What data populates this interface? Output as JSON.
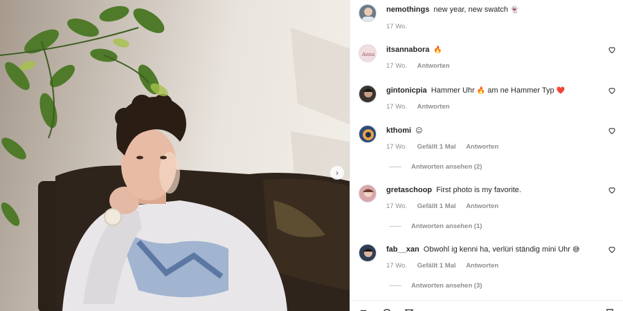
{
  "photo": {
    "next_icon": "chevron-right-icon"
  },
  "comments": [
    {
      "user": "nemothings",
      "text": "new year, new swatch",
      "emoji": "👻",
      "time": "17 Wo.",
      "likes": "",
      "reply": "",
      "view_replies": "",
      "avatar_color": "#6c7a86"
    },
    {
      "user": "itsannabora",
      "text": "",
      "emoji": "🔥",
      "time": "17 Wo.",
      "likes": "",
      "reply": "Antworten",
      "view_replies": "",
      "avatar_color": "#e9c9cf"
    },
    {
      "user": "gintonicpia",
      "text": "Hammer Uhr",
      "emoji": "🔥",
      "text2": "am ne Hammer Typ",
      "emoji2": "❤️",
      "time": "17 Wo.",
      "likes": "",
      "reply": "Antworten",
      "view_replies": "",
      "avatar_color": "#3a3532"
    },
    {
      "user": "kthomi",
      "text": "",
      "emoji": "☺",
      "time": "17 Wo.",
      "likes": "Gefällt 1 Mal",
      "reply": "Antworten",
      "view_replies": "Antworten ansehen (2)",
      "avatar_color": "#2b4a78"
    },
    {
      "user": "gretaschoop",
      "text": "First photo is my favorite.",
      "emoji": "",
      "time": "17 Wo.",
      "likes": "Gefällt 1 Mal",
      "reply": "Antworten",
      "view_replies": "Antworten ansehen (1)",
      "avatar_color": "#d8a6a8"
    },
    {
      "user": "fab__xan",
      "text": "Obwohl ig kenni ha, verlüri ständig mini Uhr",
      "emoji": "😅",
      "time": "17 Wo.",
      "likes": "Gefällt 1 Mal",
      "reply": "Antworten",
      "view_replies": "Antworten ansehen (3)",
      "avatar_color": "#2f3e55"
    }
  ],
  "icons": {
    "heart": "heart-outline-icon"
  }
}
